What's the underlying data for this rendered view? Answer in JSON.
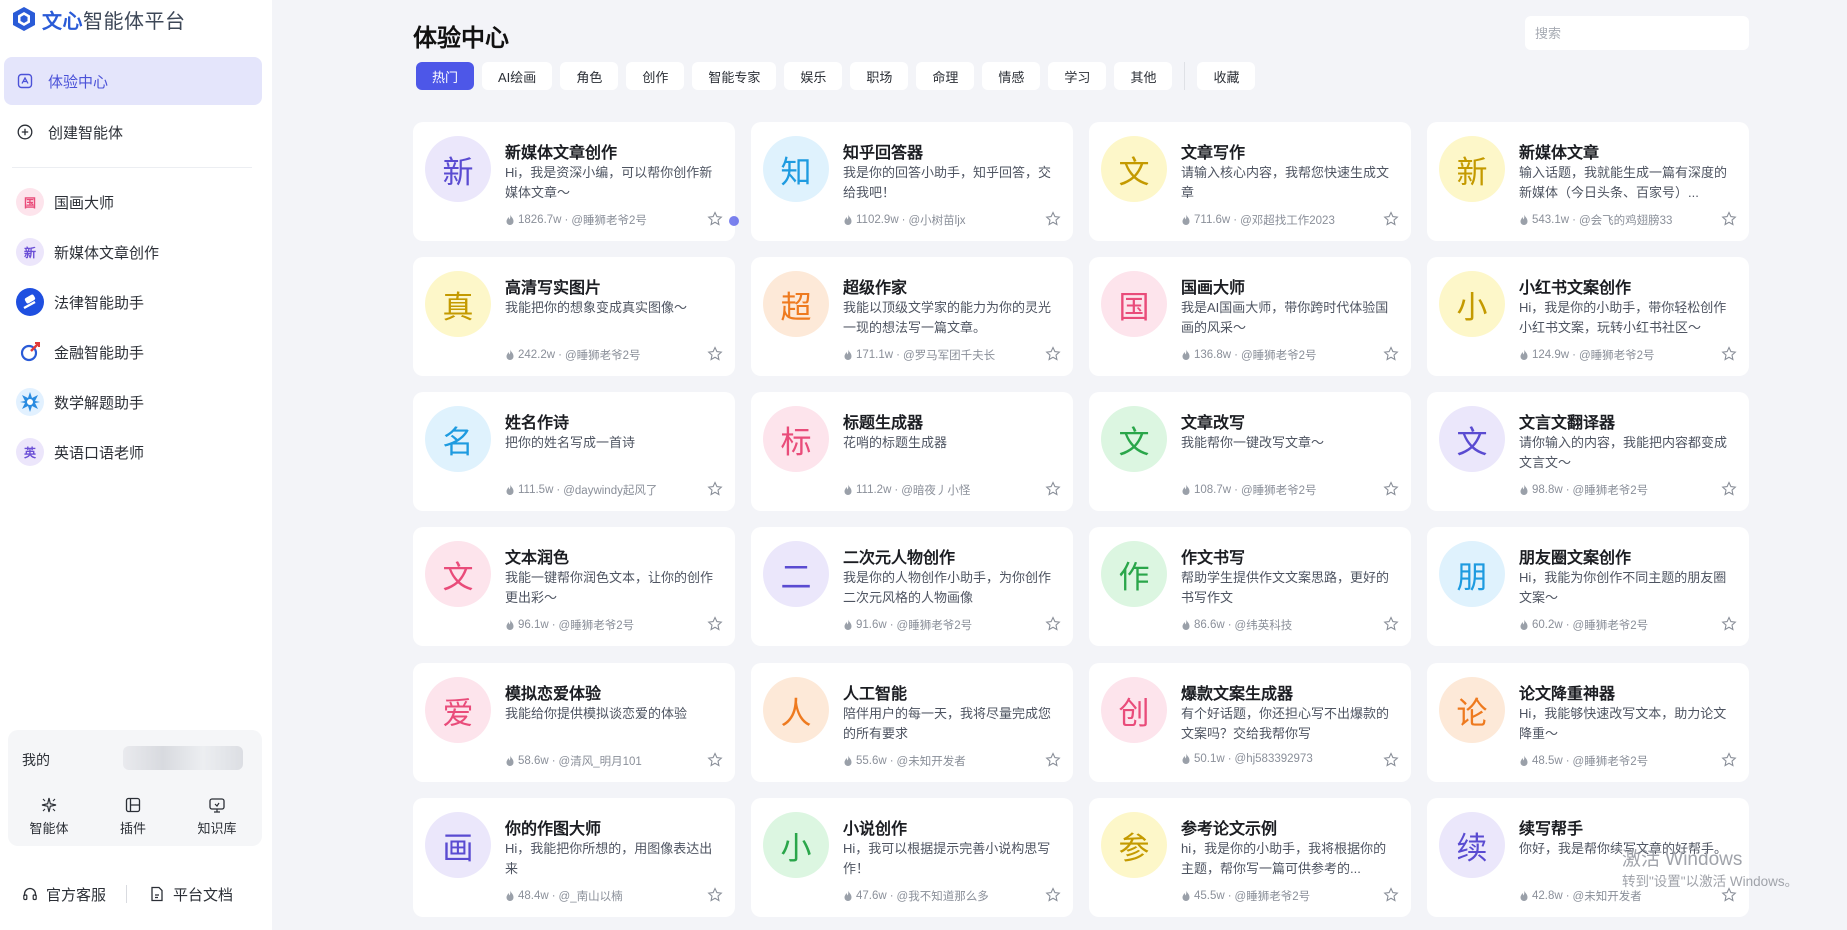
{
  "app": {
    "logo_brand": "文心",
    "logo_rest": "智能体平台"
  },
  "sidebar": {
    "nav": [
      {
        "label": "体验中心",
        "icon": "home-icon"
      },
      {
        "label": "创建智能体",
        "icon": "plus-circle-icon"
      }
    ],
    "recent": [
      {
        "label": "国画大师",
        "avatar": "国",
        "color": "#e94c7a",
        "bg": "#fde4ec"
      },
      {
        "label": "新媒体文章创作",
        "avatar": "新",
        "color": "#6b4fd6",
        "bg": "#ece6fb"
      },
      {
        "label": "法律智能助手",
        "avatar": "legal-robot-icon",
        "color": "#ffffff",
        "bg": "#1f4fe0"
      },
      {
        "label": "金融智能助手",
        "avatar": "finance-chart-icon",
        "color": "#e03a3a",
        "bg": "#ffffff"
      },
      {
        "label": "数学解题助手",
        "avatar": "math-burst-icon",
        "color": "#2a8be0",
        "bg": "#e2f1ff"
      },
      {
        "label": "英语口语老师",
        "avatar": "英",
        "color": "#6b4fd6",
        "bg": "#ece6fb"
      }
    ],
    "mine": {
      "label": "我的",
      "tools": [
        {
          "label": "智能体",
          "icon": "sparkle-icon"
        },
        {
          "label": "插件",
          "icon": "plugin-icon"
        },
        {
          "label": "知识库",
          "icon": "knowledge-base-icon"
        }
      ]
    },
    "footer": {
      "support": "官方客服",
      "docs": "平台文档"
    }
  },
  "header": {
    "title": "体验中心",
    "search_placeholder": "搜索"
  },
  "tabs": [
    {
      "label": "热门",
      "active": true
    },
    {
      "label": "AI绘画"
    },
    {
      "label": "角色"
    },
    {
      "label": "创作"
    },
    {
      "label": "智能专家"
    },
    {
      "label": "娱乐"
    },
    {
      "label": "职场"
    },
    {
      "label": "命理"
    },
    {
      "label": "情感"
    },
    {
      "label": "学习"
    },
    {
      "label": "其他"
    }
  ],
  "favorites_tab": "收藏",
  "cards": [
    {
      "char": "新",
      "title": "新媒体文章创作",
      "desc": "Hi，我是资深小编，可以帮你创作新媒体文章～",
      "views": "1826.7w",
      "author": "@睡狮老爷2号",
      "color": "#5a4bd1",
      "bg": "#ebe7fb"
    },
    {
      "char": "知",
      "title": "知乎回答器",
      "desc": "我是你的回答小助手，知乎回答，交给我吧！",
      "views": "1102.9w",
      "author": "@小树苗ljx",
      "color": "#1e9be0",
      "bg": "#dff2fd"
    },
    {
      "char": "文",
      "title": "文章写作",
      "desc": "请输入核心内容，我帮您快速生成文章",
      "views": "711.6w",
      "author": "@邓超找工作2023",
      "color": "#c49a00",
      "bg": "#fdf7c9"
    },
    {
      "char": "新",
      "title": "新媒体文章",
      "desc": "输入话题，我就能生成一篇有深度的新媒体（今日头条、百家号）...",
      "views": "543.1w",
      "author": "@会飞的鸡翅膀33",
      "color": "#c49a00",
      "bg": "#fdf7c9"
    },
    {
      "char": "真",
      "title": "高清写实图片",
      "desc": "我能把你的想象变成真实图像～",
      "views": "242.2w",
      "author": "@睡狮老爷2号",
      "color": "#c49a00",
      "bg": "#fdf7c9"
    },
    {
      "char": "超",
      "title": "超级作家",
      "desc": "我能以顶级文学家的能力为你的灵光一现的想法写一篇文章。",
      "views": "171.1w",
      "author": "@罗马军团千夫长",
      "color": "#ee7a1f",
      "bg": "#fde9d8"
    },
    {
      "char": "国",
      "title": "国画大师",
      "desc": "我是AI国画大师，带你跨时代体验国画的风采～",
      "views": "136.8w",
      "author": "@睡狮老爷2号",
      "color": "#e94c7a",
      "bg": "#fde4ec"
    },
    {
      "char": "小",
      "title": "小红书文案创作",
      "desc": "Hi，我是你的小助手，带你轻松创作小红书文案，玩转小红书社区～",
      "views": "124.9w",
      "author": "@睡狮老爷2号",
      "color": "#c49a00",
      "bg": "#fdf7c9"
    },
    {
      "char": "名",
      "title": "姓名作诗",
      "desc": "把你的姓名写成一首诗",
      "views": "111.5w",
      "author": "@daywindy起风了",
      "color": "#1e9be0",
      "bg": "#dff2fd"
    },
    {
      "char": "标",
      "title": "标题生成器",
      "desc": "花哨的标题生成器",
      "views": "111.2w",
      "author": "@暗夜丿小怪",
      "color": "#e94c7a",
      "bg": "#fde4ec"
    },
    {
      "char": "文",
      "title": "文章改写",
      "desc": "我能帮你一键改写文章～",
      "views": "108.7w",
      "author": "@睡狮老爷2号",
      "color": "#2aa64a",
      "bg": "#dcf6e1"
    },
    {
      "char": "文",
      "title": "文言文翻译器",
      "desc": "请你输入的内容，我能把内容都变成文言文～",
      "views": "98.8w",
      "author": "@睡狮老爷2号",
      "color": "#5a4bd1",
      "bg": "#ebe7fb"
    },
    {
      "char": "文",
      "title": "文本润色",
      "desc": "我能一键帮你润色文本，让你的创作更出彩～",
      "views": "96.1w",
      "author": "@睡狮老爷2号",
      "color": "#e94c7a",
      "bg": "#fde4ec"
    },
    {
      "char": "二",
      "title": "二次元人物创作",
      "desc": "我是你的人物创作小助手，为你创作二次元风格的人物画像",
      "views": "91.6w",
      "author": "@睡狮老爷2号",
      "color": "#5a4bd1",
      "bg": "#ebe7fb"
    },
    {
      "char": "作",
      "title": "作文书写",
      "desc": "帮助学生提供作文文案思路，更好的书写作文",
      "views": "86.6w",
      "author": "@纬英科技",
      "color": "#2aa64a",
      "bg": "#dcf6e1"
    },
    {
      "char": "朋",
      "title": "朋友圈文案创作",
      "desc": "Hi，我能为你创作不同主题的朋友圈文案～",
      "views": "60.2w",
      "author": "@睡狮老爷2号",
      "color": "#1e9be0",
      "bg": "#dff2fd"
    },
    {
      "char": "爱",
      "title": "模拟恋爱体验",
      "desc": "我能给你提供模拟谈恋爱的体验",
      "views": "58.6w",
      "author": "@清风_明月101",
      "color": "#e94c7a",
      "bg": "#fde4ec"
    },
    {
      "char": "人",
      "title": "人工智能",
      "desc": "陪伴用户的每一天，我将尽量完成您的所有要求",
      "views": "55.6w",
      "author": "@未知开发者",
      "color": "#ee7a1f",
      "bg": "#fde9d8"
    },
    {
      "char": "创",
      "title": "爆款文案生成器",
      "desc": "有个好话题，你还担心写不出爆款的文案吗？交给我帮你写",
      "views": "50.1w",
      "author": "@hj583392973",
      "color": "#e94c7a",
      "bg": "#fde4ec"
    },
    {
      "char": "论",
      "title": "论文降重神器",
      "desc": "Hi，我能够快速改写文本，助力论文降重～",
      "views": "48.5w",
      "author": "@睡狮老爷2号",
      "color": "#ee7a1f",
      "bg": "#fde9d8"
    },
    {
      "char": "画",
      "title": "你的作图大师",
      "desc": "Hi，我能把你所想的，用图像表达出来",
      "views": "48.4w",
      "author": "@_南山以楠",
      "color": "#5a4bd1",
      "bg": "#ebe7fb"
    },
    {
      "char": "小",
      "title": "小说创作",
      "desc": "Hi，我可以根据提示完善小说构思写作！",
      "views": "47.6w",
      "author": "@我不知道那么多",
      "color": "#2aa64a",
      "bg": "#dcf6e1"
    },
    {
      "char": "参",
      "title": "参考论文示例",
      "desc": "hi，我是你的小助手，我将根据你的主题，帮你写一篇可供参考的...",
      "views": "45.5w",
      "author": "@睡狮老爷2号",
      "color": "#c49a00",
      "bg": "#fdf7c9"
    },
    {
      "char": "续",
      "title": "续写帮手",
      "desc": "你好，我是帮你续写文章的好帮手。",
      "views": "42.8w",
      "author": "@未知开发者",
      "color": "#5a4bd1",
      "bg": "#ebe7fb"
    }
  ],
  "watermark": {
    "line1": "激活 Windows",
    "line2": "转到\"设置\"以激活 Windows。"
  }
}
